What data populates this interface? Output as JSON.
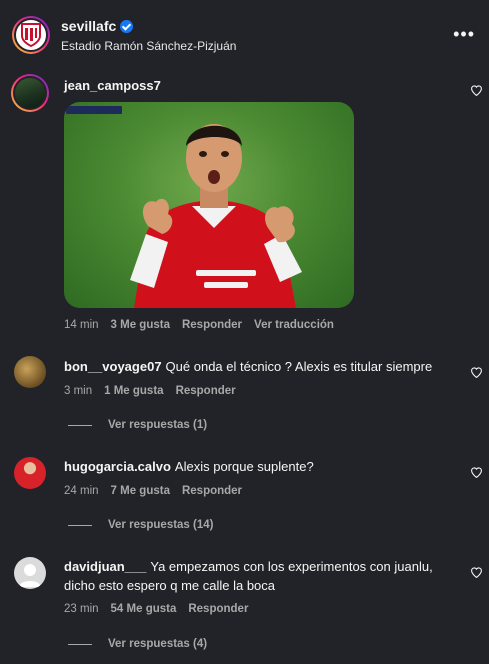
{
  "header": {
    "username": "sevillafc",
    "location": "Estadio Ramón Sánchez-Pizjuán",
    "more_icon": "more-horizontal-icon"
  },
  "comments": [
    {
      "username": "jean_camposs7",
      "text": "",
      "time": "14 min",
      "likes": "3 Me gusta",
      "reply": "Responder",
      "translate": "Ver traducción",
      "has_gif": true
    },
    {
      "username": "bon__voyage07",
      "text": "Qué onda el técnico ? Alexis es titular siempre",
      "time": "3 min",
      "likes": "1 Me gusta",
      "reply": "Responder",
      "view_replies": "Ver respuestas (1)"
    },
    {
      "username": "hugogarcia.calvo",
      "text": "Alexis porque suplente?",
      "time": "24 min",
      "likes": "7 Me gusta",
      "reply": "Responder",
      "view_replies": "Ver respuestas (14)"
    },
    {
      "username": "davidjuan___",
      "text_line1": "Ya empezamos con los experimentos con juanlu,",
      "text_line2": "dicho esto espero q me calle la boca",
      "time": "23 min",
      "likes": "54 Me gusta",
      "reply": "Responder",
      "view_replies": "Ver respuestas (4)"
    }
  ],
  "colors": {
    "background": "#212328",
    "text": "#f5f5f5",
    "muted": "#a8a8a8",
    "verified": "#1877f2"
  }
}
